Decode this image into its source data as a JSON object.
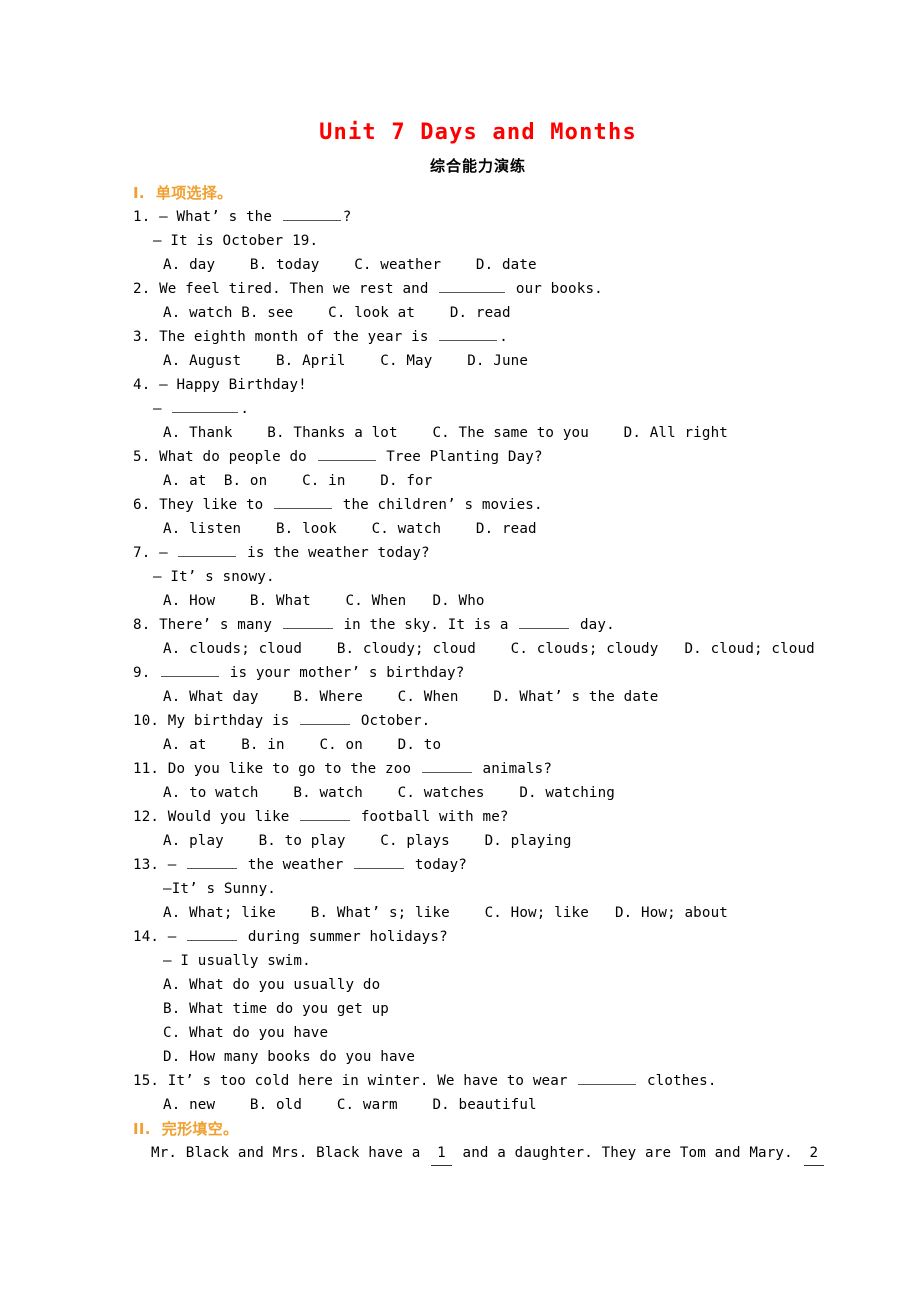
{
  "document": {
    "title": "Unit 7 Days and Months",
    "subtitle": "综合能力演练",
    "title_color": "#FF0000",
    "section_color": "#F0A030"
  },
  "sections": [
    {
      "numeral": "I.",
      "heading_cn": "单项选择。",
      "heading_full": "I.  单项选择。"
    },
    {
      "numeral": "II.",
      "heading_cn": "完形填空。",
      "heading_full": "II.  完形填空。"
    }
  ],
  "questions": [
    {
      "num": "1.",
      "stem_a": "1. — What’ s the ",
      "stem_b": "?",
      "dash_line": "— It is October 19.",
      "options": "A. day    B. today    C. weather    D. date"
    },
    {
      "num": "2.",
      "stem_a": "2. We feel tired. Then we rest and ",
      "stem_b": " our books.",
      "options": "A. watch B. see    C. look at    D. read"
    },
    {
      "num": "3.",
      "stem_a": "3. The eighth month of the year is ",
      "stem_b": ".",
      "options": "A. August    B. April    C. May    D. June"
    },
    {
      "num": "4.",
      "stem_a": "4. — Happy Birthday!",
      "stem_b": "",
      "dash_line_a": "— ",
      "dash_line_b": ".",
      "options": "A. Thank    B. Thanks a lot    C. The same to you    D. All right"
    },
    {
      "num": "5.",
      "stem_a": "5. What do people do ",
      "stem_b": " Tree Planting Day?",
      "options": "A. at  B. on    C. in    D. for"
    },
    {
      "num": "6.",
      "stem_a": "6. They like to ",
      "stem_b": " the children’ s movies.",
      "options": "A. listen    B. look    C. watch    D. read"
    },
    {
      "num": "7.",
      "stem_a": "7. — ",
      "stem_b": " is the weather today?",
      "dash_line": "— It’ s snowy.",
      "options": "A. How    B. What    C. When   D. Who"
    },
    {
      "num": "8.",
      "stem_a": "8. There’ s many ",
      "stem_mid": " in the sky. It is a ",
      "stem_b": " day.",
      "options": "A. clouds; cloud    B. cloudy; cloud    C. clouds; cloudy   D. cloud; cloud"
    },
    {
      "num": "9.",
      "stem_a": "9. ",
      "stem_b": " is your mother’ s birthday?",
      "options": "A. What day    B. Where    C. When    D. What’ s the date"
    },
    {
      "num": "10.",
      "stem_a": "10. My birthday is ",
      "stem_b": " October.",
      "options": "A. at    B. in    C. on    D. to"
    },
    {
      "num": "11.",
      "stem_a": "11. Do you like to go to the zoo ",
      "stem_b": " animals?",
      "options": "A. to watch    B. watch    C. watches    D. watching"
    },
    {
      "num": "12.",
      "stem_a": "12. Would you like ",
      "stem_b": " football with me?",
      "options": "A. play    B. to play    C. plays    D. playing"
    },
    {
      "num": "13.",
      "stem_a": "13. — ",
      "stem_mid": " the weather ",
      "stem_b": " today?",
      "dash_line": "—It’ s Sunny.",
      "options": "A. What; like    B. What’ s; like    C. How; like   D. How; about"
    },
    {
      "num": "14.",
      "stem_a": "14. — ",
      "stem_b": " during summer holidays?",
      "dash_line": "— I usually swim.",
      "options_list": [
        "A. What do you usually do",
        "B. What time do you get up",
        "C. What do you have",
        "D. How many books do you have"
      ]
    },
    {
      "num": "15.",
      "stem_a": "15. It’ s too cold here in winter. We have to wear ",
      "stem_b": " clothes.",
      "options": "A. new    B. old    C. warm    D. beautiful"
    }
  ],
  "cloze": {
    "part_a": "Mr. Black and Mrs. Black have a ",
    "blank_1": "1",
    "part_b": " and a daughter. They are Tom and Mary. ",
    "blank_2": "2"
  }
}
